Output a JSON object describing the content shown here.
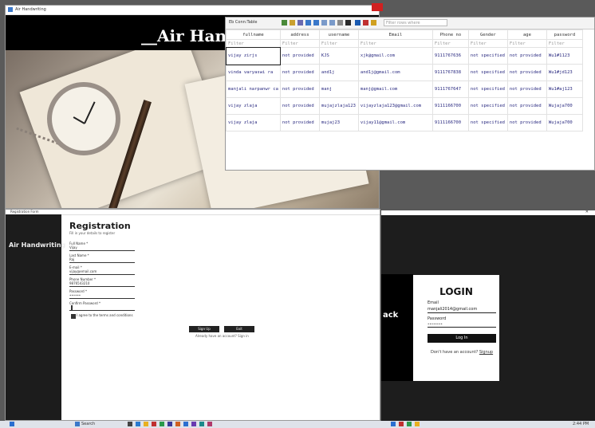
{
  "window1": {
    "title": "Air Handwriting",
    "banner": "__Air Handwr"
  },
  "sheet": {
    "label": "Eb Conn:Table",
    "filter_placeholder": "Filter rows where",
    "columns": [
      "fullname",
      "address",
      "username",
      "Email",
      "Phone no",
      "Gender",
      "age",
      "password"
    ],
    "filter_cells": [
      "Filter",
      "Filter",
      "Filter",
      "Filter",
      "Filter",
      "Filter",
      "Filter",
      "Filter"
    ],
    "rows": [
      [
        "vijay zirjs",
        "not provided",
        "KJS",
        "xjk@gmail.com",
        "9111767636",
        "not specified",
        "not provided",
        "Wu1#1123"
      ],
      [
        "vinda varyaswi ra",
        "not provided",
        "and1j",
        "and1j@gmail.com",
        "9111767838",
        "not specified",
        "not provided",
        "Wu1#jd123"
      ],
      [
        "manjali narpanwr ca",
        "not provided",
        "manj",
        "manj@gmail.com",
        "9111767647",
        "not specified",
        "not provided",
        "Wu1#aj123"
      ],
      [
        "vijay zlaja",
        "not provided",
        "mujajzlaja123",
        "vijayzlaja123@gmail.com",
        "9111166700",
        "not specified",
        "not provided",
        "Wujaja700"
      ],
      [
        "vijay zlaja",
        "not provided",
        "mujaj23",
        "vijay11@gmail.com",
        "9111166700",
        "not specified",
        "not provided",
        "Wujaja700"
      ]
    ]
  },
  "registration": {
    "titlebar": "Registration Form",
    "side_title": "Air Handwriting",
    "heading": "Registration",
    "subheading": "Fill in your details to register",
    "fields": [
      {
        "label": "Full Name *",
        "value": "Vijay"
      },
      {
        "label": "Last Name *",
        "value": "Raj"
      },
      {
        "label": "E-mail *",
        "value": "vijay@email.com"
      },
      {
        "label": "Phone Number *",
        "value": "9876543210"
      },
      {
        "label": "Password *",
        "value": "••••••"
      },
      {
        "label": "Confirm Password *",
        "value": ""
      }
    ],
    "agree_label": "I agree to the terms and conditions",
    "signup_label": "Sign Up",
    "exit_label": "Exit",
    "already_link": "Already have an account? Sign in"
  },
  "login": {
    "side_label": "ack",
    "heading": "LOGIN",
    "email_label": "Email",
    "email_value": "manjali2014@gmail.com",
    "password_label": "Password",
    "password_value": "••••••••",
    "login_button": "Log In",
    "signup_text": "Don't have an account?",
    "signup_link": "Signup"
  },
  "taskbar": {
    "search_label": "Search",
    "time": "2:44 PM"
  },
  "colors": {
    "banner_bg": "#000000",
    "side_bg": "#1c1c1c",
    "accent_close": "#d02020",
    "sheet_text": "#2a2a80"
  }
}
